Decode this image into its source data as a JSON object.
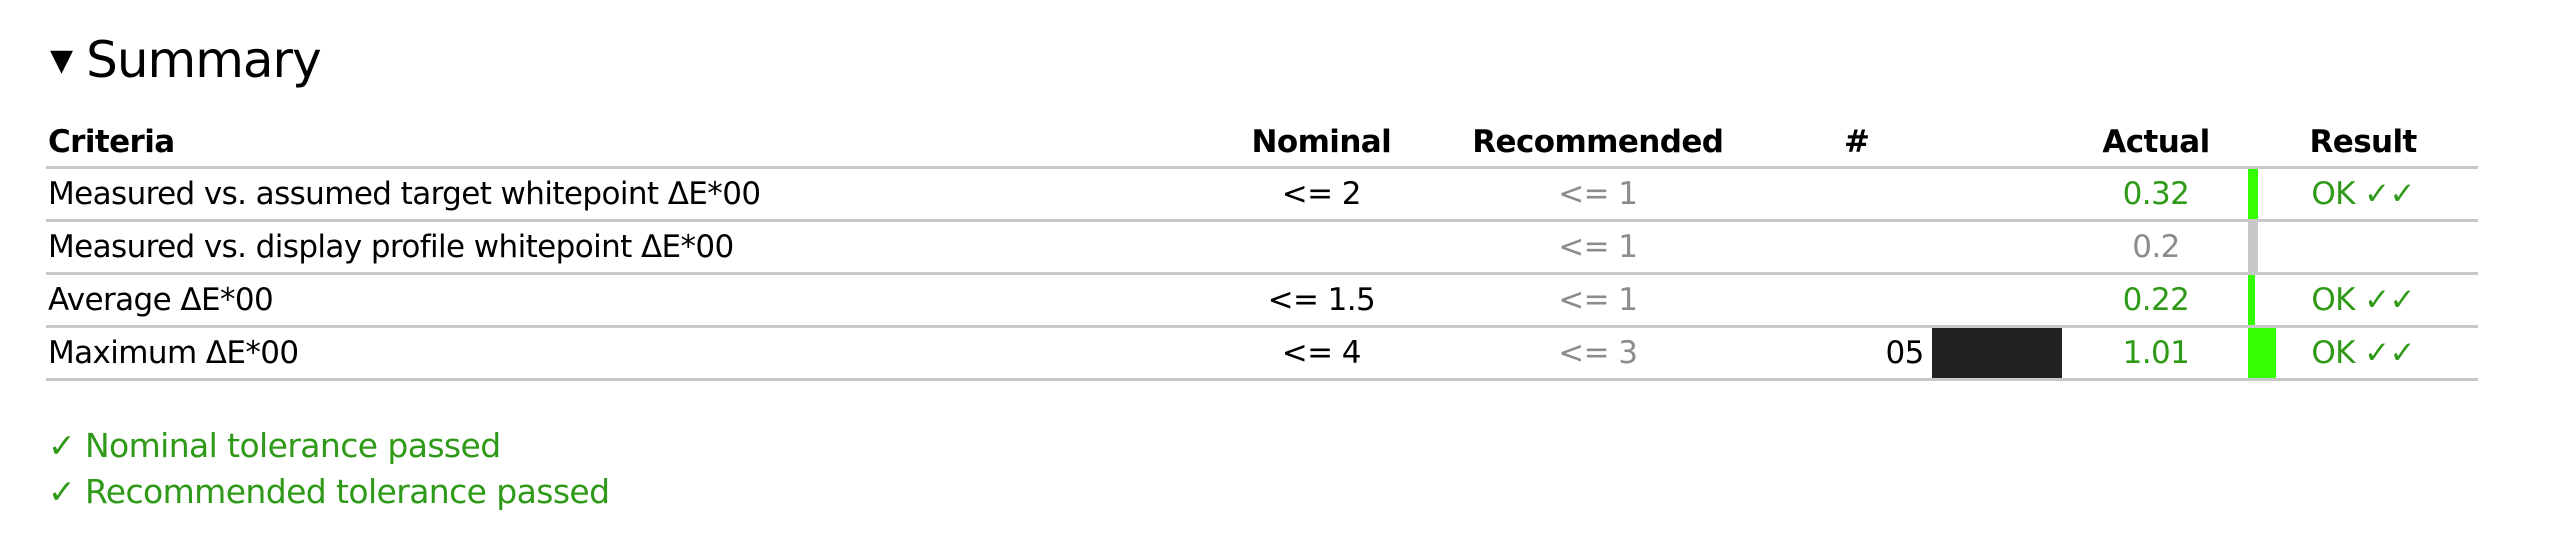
{
  "section": {
    "title": "Summary",
    "collapse_icon": "triangle-down-icon"
  },
  "table": {
    "headers": {
      "criteria": "Criteria",
      "nominal": "Nominal",
      "recommended": "Recommended",
      "number": "#",
      "actual": "Actual",
      "result": "Result"
    },
    "rows": [
      {
        "criteria": "Measured vs. assumed target whitepoint ΔE*00",
        "nominal": "<= 2",
        "recommended": "<= 1",
        "number": "",
        "swatch": "",
        "actual": "0.32",
        "actual_status": "ok",
        "bar_fraction": 0.16,
        "bar_color": "#33ff00",
        "result": "OK ✓✓"
      },
      {
        "criteria": "Measured vs. display profile whitepoint ΔE*00",
        "nominal": "",
        "recommended": "<= 1",
        "number": "",
        "swatch": "",
        "actual": "0.2",
        "actual_status": "na",
        "bar_fraction": 0.16,
        "bar_color": "#c8c8c8",
        "result": ""
      },
      {
        "criteria": "Average ΔE*00",
        "nominal": "<= 1.5",
        "recommended": "<= 1",
        "number": "",
        "swatch": "",
        "actual": "0.22",
        "actual_status": "ok",
        "bar_fraction": 0.11,
        "bar_color": "#33ff00",
        "result": "OK ✓✓"
      },
      {
        "criteria": "Maximum ΔE*00",
        "nominal": "<= 4",
        "recommended": "<= 3",
        "number": "05",
        "swatch": "#222222",
        "actual": "1.01",
        "actual_status": "ok",
        "bar_fraction": 0.45,
        "bar_color": "#33ff00",
        "result": "OK ✓✓"
      }
    ]
  },
  "footer": {
    "lines": [
      "✓ Nominal tolerance passed",
      "✓ Recommended tolerance passed"
    ]
  },
  "colors": {
    "pass_text": "#2e9a18",
    "pass_bar": "#33ff00",
    "neutral": "#8c8c8c",
    "rule": "#c8c8c8"
  }
}
